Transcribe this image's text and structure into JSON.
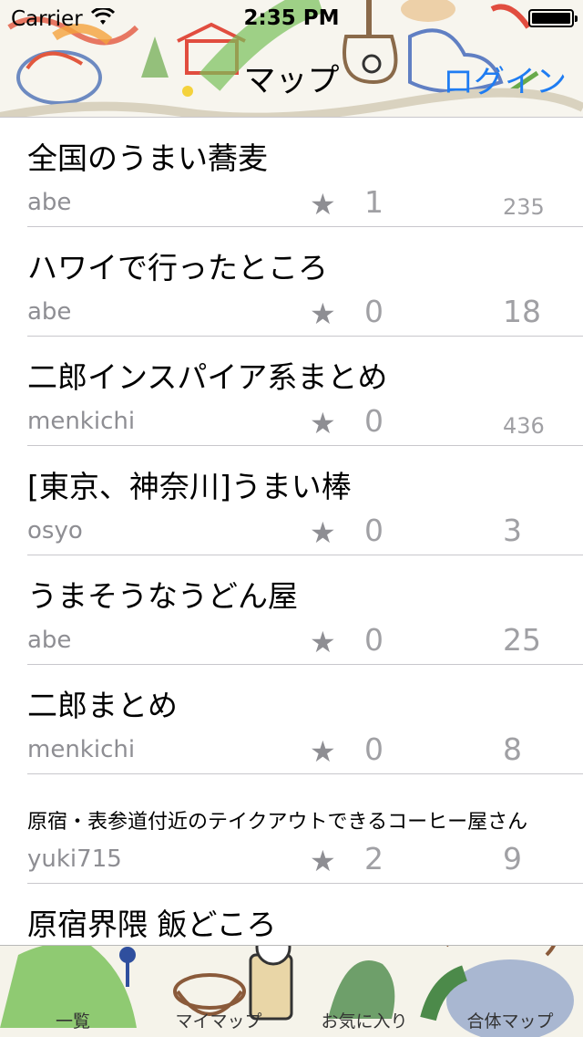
{
  "status_bar": {
    "carrier": "Carrier",
    "time": "2:35 PM"
  },
  "nav": {
    "title": "マップ",
    "login": "ログイン"
  },
  "list": [
    {
      "title": "全国のうまい蕎麦",
      "author": "abe",
      "favorites": "1",
      "count": "235"
    },
    {
      "title": "ハワイで行ったところ",
      "author": "abe",
      "favorites": "0",
      "count": "18"
    },
    {
      "title": "二郎インスパイア系まとめ",
      "author": "menkichi",
      "favorites": "0",
      "count": "436"
    },
    {
      "title": "[東京、神奈川]うまい棒",
      "author": "osyo",
      "favorites": "0",
      "count": "3"
    },
    {
      "title": "うまそうなうどん屋",
      "author": "abe",
      "favorites": "0",
      "count": "25"
    },
    {
      "title": "二郎まとめ",
      "author": "menkichi",
      "favorites": "0",
      "count": "8"
    },
    {
      "title": "原宿・表参道付近のテイクアウトできるコーヒー屋さん",
      "author": "yuki715",
      "favorites": "2",
      "count": "9"
    },
    {
      "title": "原宿界隈 飯どころ"
    }
  ],
  "tabs": [
    "一覧",
    "マイマップ",
    "お気に入り",
    "合体マップ"
  ],
  "colors": {
    "accent": "#1e7cf2",
    "secondary_text": "#8e8e93",
    "separator": "#c8c7cc"
  }
}
